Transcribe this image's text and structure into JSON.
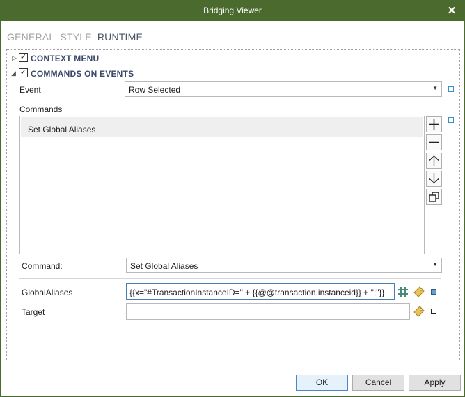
{
  "window": {
    "title": "Bridging Viewer",
    "close_symbol": "✕"
  },
  "tabs": [
    {
      "label": "GENERAL",
      "active": false
    },
    {
      "label": "STYLE",
      "active": false
    },
    {
      "label": "RUNTIME",
      "active": true
    }
  ],
  "sections": {
    "context_menu": {
      "label": "CONTEXT MENU",
      "checked": true,
      "expanded": false
    },
    "commands_on_events": {
      "label": "COMMANDS ON EVENTS",
      "checked": true,
      "expanded": true
    }
  },
  "event": {
    "label": "Event",
    "value": "Row Selected"
  },
  "commands": {
    "label": "Commands",
    "items": [
      "Set Global Aliases"
    ]
  },
  "command": {
    "label": "Command:",
    "value": "Set Global Aliases"
  },
  "global_aliases": {
    "label": "GlobalAliases",
    "value": "{{x=\"#TransactionInstanceID=\" + {{@@transaction.instanceid}} + \";\"}}"
  },
  "target": {
    "label": "Target",
    "value": ""
  },
  "footer": {
    "ok": "OK",
    "cancel": "Cancel",
    "apply": "Apply"
  },
  "colors": {
    "titlebar": "#4a6a2e",
    "section_text": "#3c4a6a",
    "active_tab": "#4a5466",
    "inactive_tab": "#a3a3a3"
  }
}
